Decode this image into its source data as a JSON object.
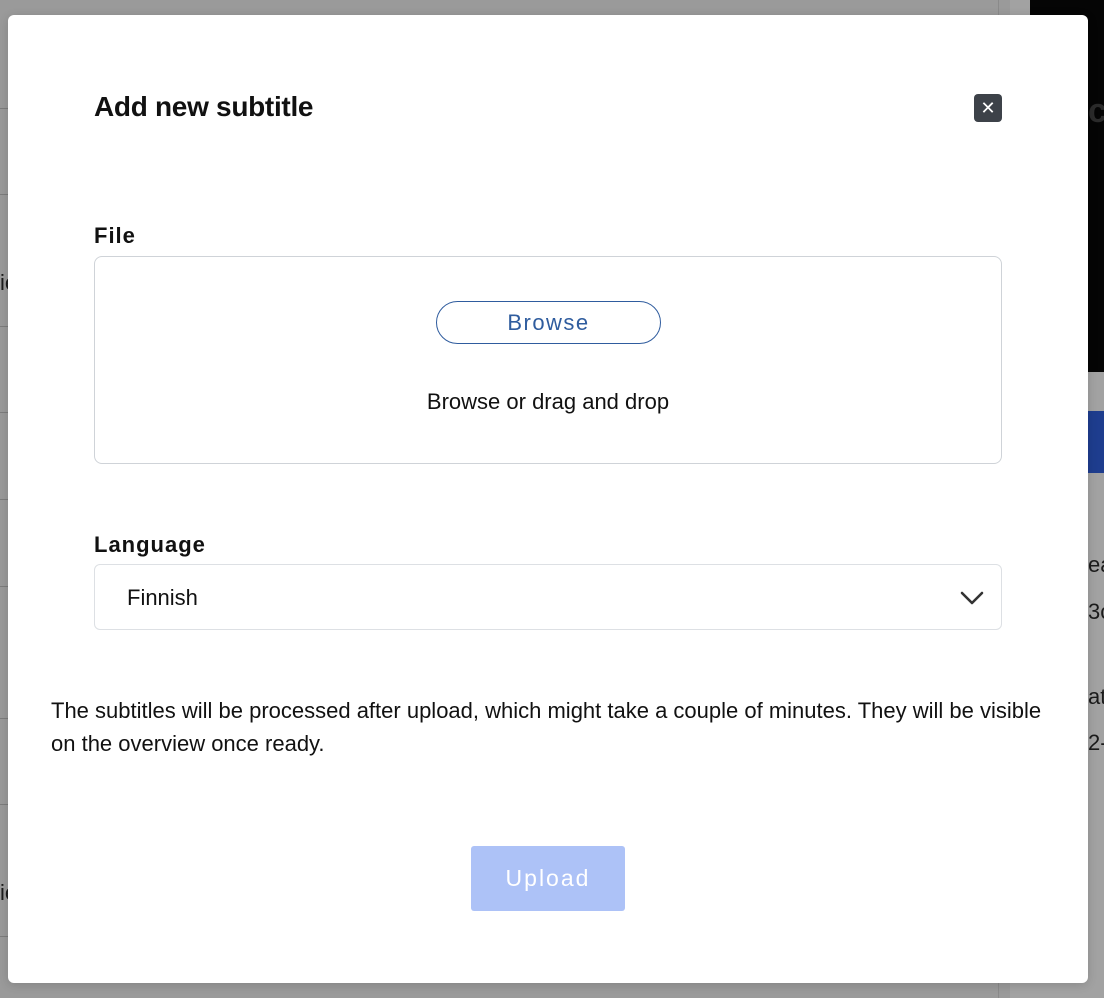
{
  "background": {
    "left_fragments": [
      "ie",
      "ie"
    ],
    "right_fragments": [
      "c",
      "ea",
      "3c",
      "at",
      "2-"
    ]
  },
  "modal": {
    "title": "Add new subtitle",
    "close_icon": "close-icon",
    "file": {
      "label": "File",
      "browse_label": "Browse",
      "hint": "Browse or drag and drop"
    },
    "language": {
      "label": "Language",
      "selected": "Finnish",
      "chevron_icon": "chevron-down-icon"
    },
    "info": "The subtitles will be processed after upload, which might take a couple of minutes. They will be visible on the overview once ready.",
    "upload_label": "Upload"
  },
  "colors": {
    "overlay": "#9a9a9a",
    "browse_accent": "#2f5c9e",
    "upload_disabled": "#adc2f7",
    "close_bg": "#3d4249"
  }
}
